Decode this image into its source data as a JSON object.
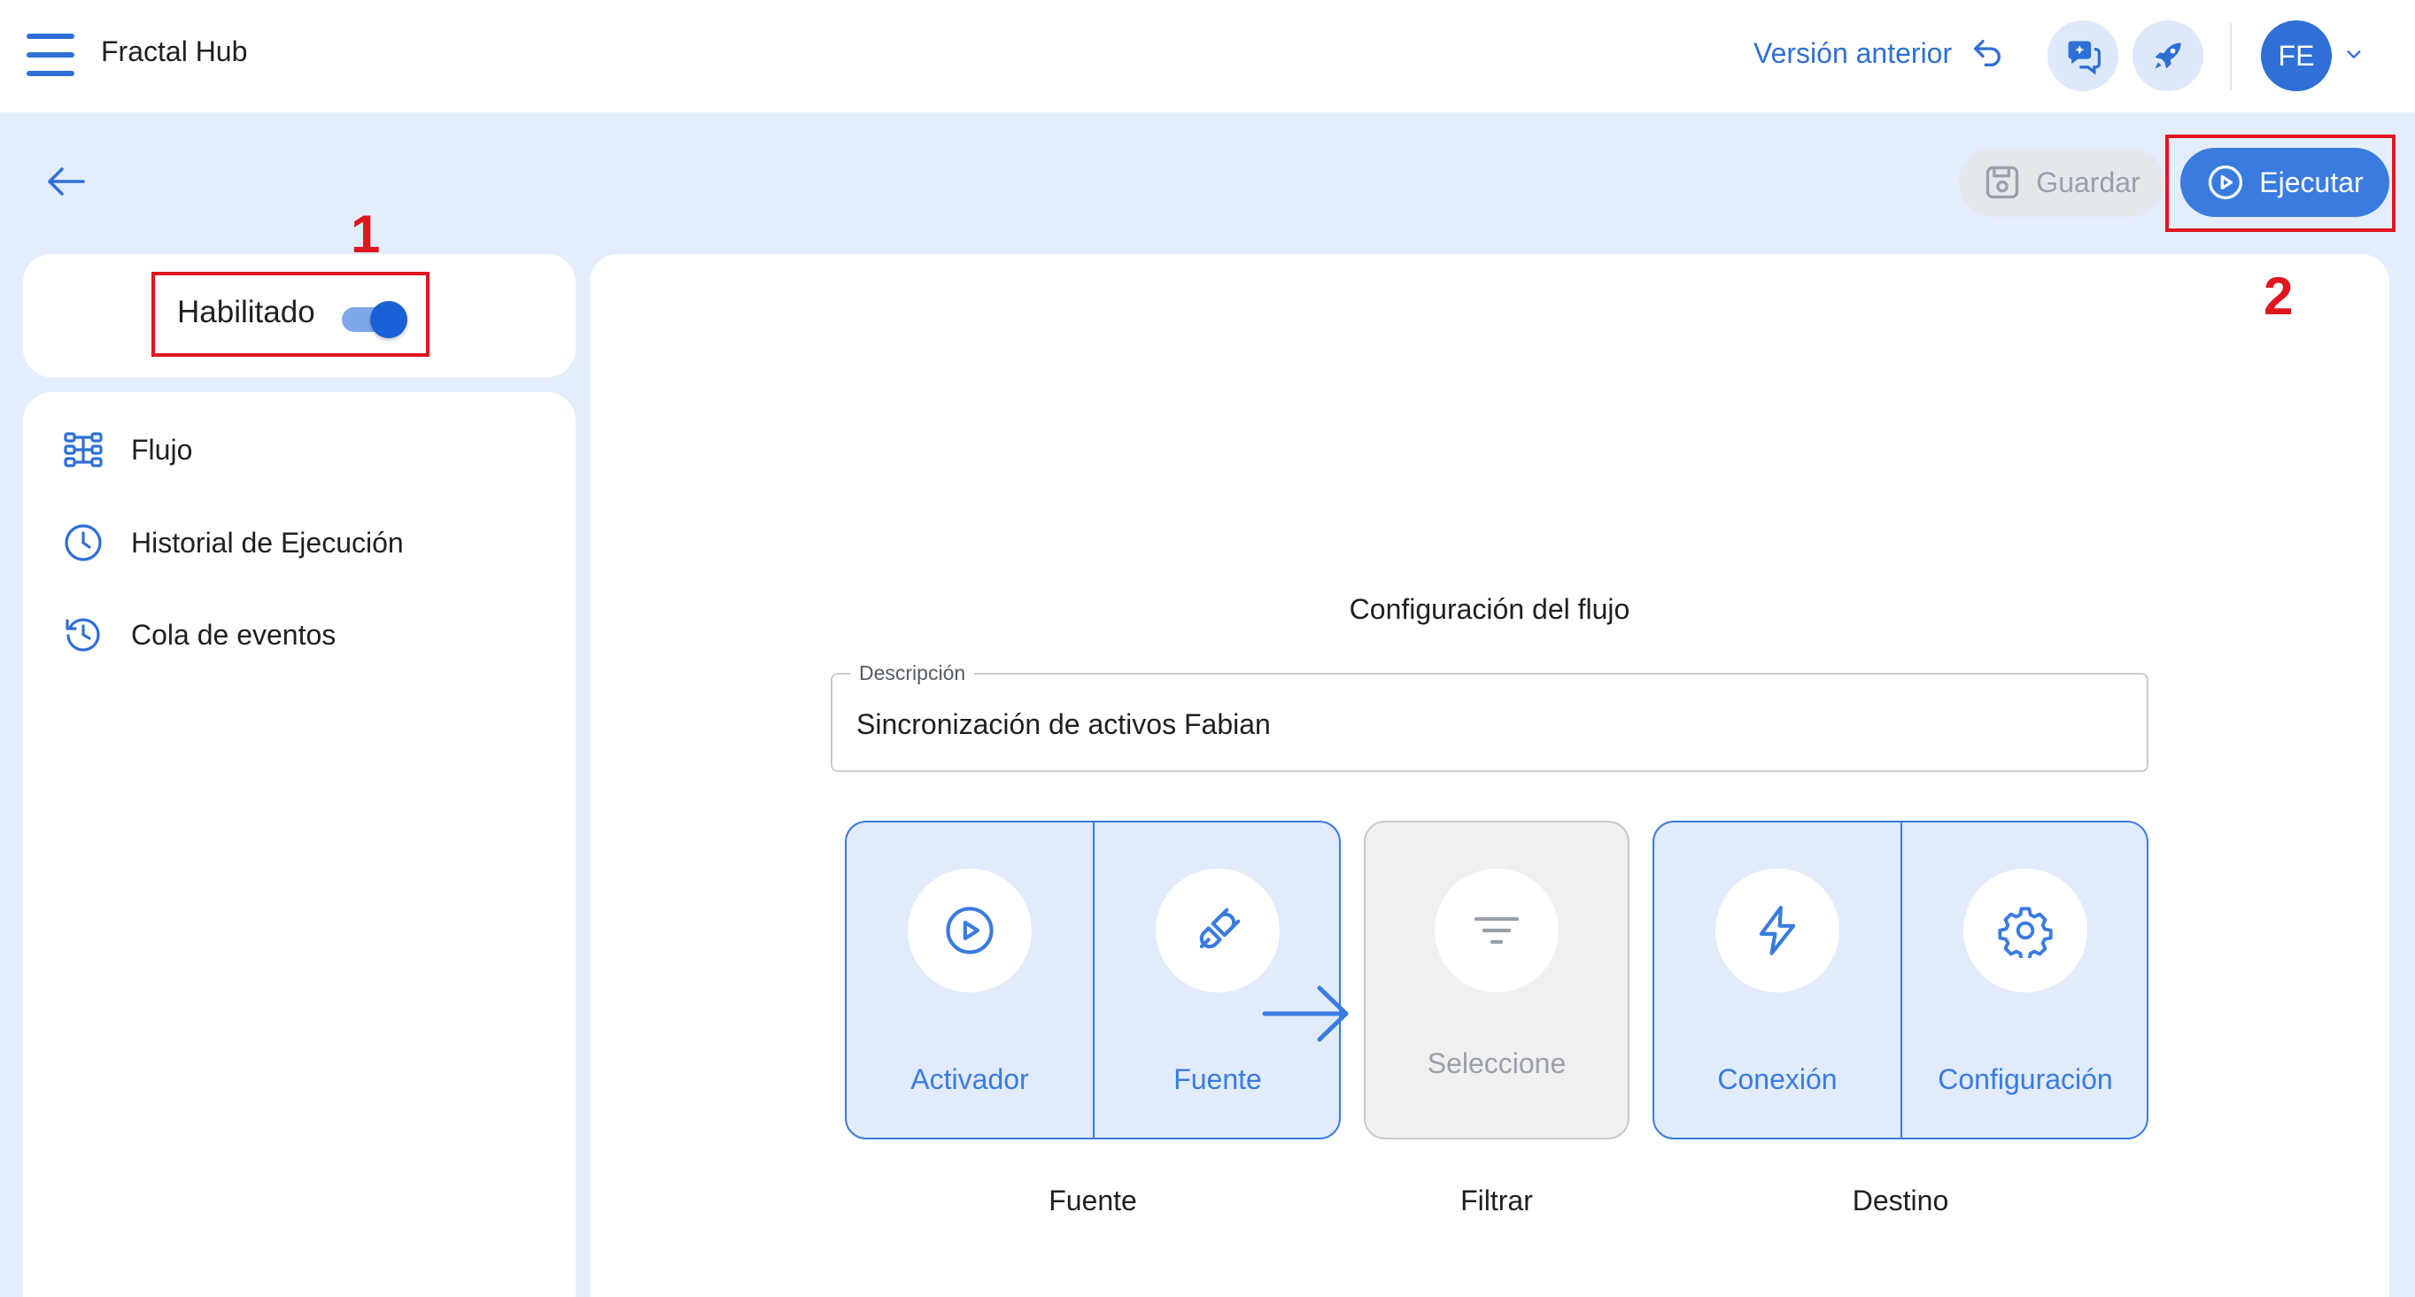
{
  "header": {
    "app_title": "Fractal Hub",
    "prev_version_label": "Versión anterior",
    "avatar_initials": "FE"
  },
  "toolbar": {
    "save_label": "Guardar",
    "run_label": "Ejecutar"
  },
  "status_card": {
    "toggle_label": "Habilitado",
    "enabled": true
  },
  "sidebar": {
    "items": [
      {
        "label": "Flujo",
        "icon": "flow-icon"
      },
      {
        "label": "Historial de Ejecución",
        "icon": "clock-icon"
      },
      {
        "label": "Cola de eventos",
        "icon": "history-icon"
      }
    ]
  },
  "main": {
    "section_title": "Configuración del flujo",
    "description": {
      "legend": "Descripción",
      "value": "Sincronización de activos Fabian"
    },
    "groups": [
      {
        "caption": "Fuente",
        "cells": [
          {
            "label": "Activador",
            "icon": "play-circle-icon"
          },
          {
            "label": "Fuente",
            "icon": "plug-icon"
          }
        ]
      },
      {
        "caption": "Filtrar",
        "cells": [
          {
            "label": "Seleccione",
            "icon": "filter-icon"
          }
        ]
      },
      {
        "caption": "Destino",
        "cells": [
          {
            "label": "Conexión",
            "icon": "bolt-icon"
          },
          {
            "label": "Configuración",
            "icon": "gear-icon"
          }
        ]
      }
    ]
  },
  "annotations": {
    "marker_1": "1",
    "marker_2": "2"
  },
  "colors": {
    "accent": "#3a7be0",
    "annotation": "#e0161f",
    "background": "#e4edfc"
  }
}
